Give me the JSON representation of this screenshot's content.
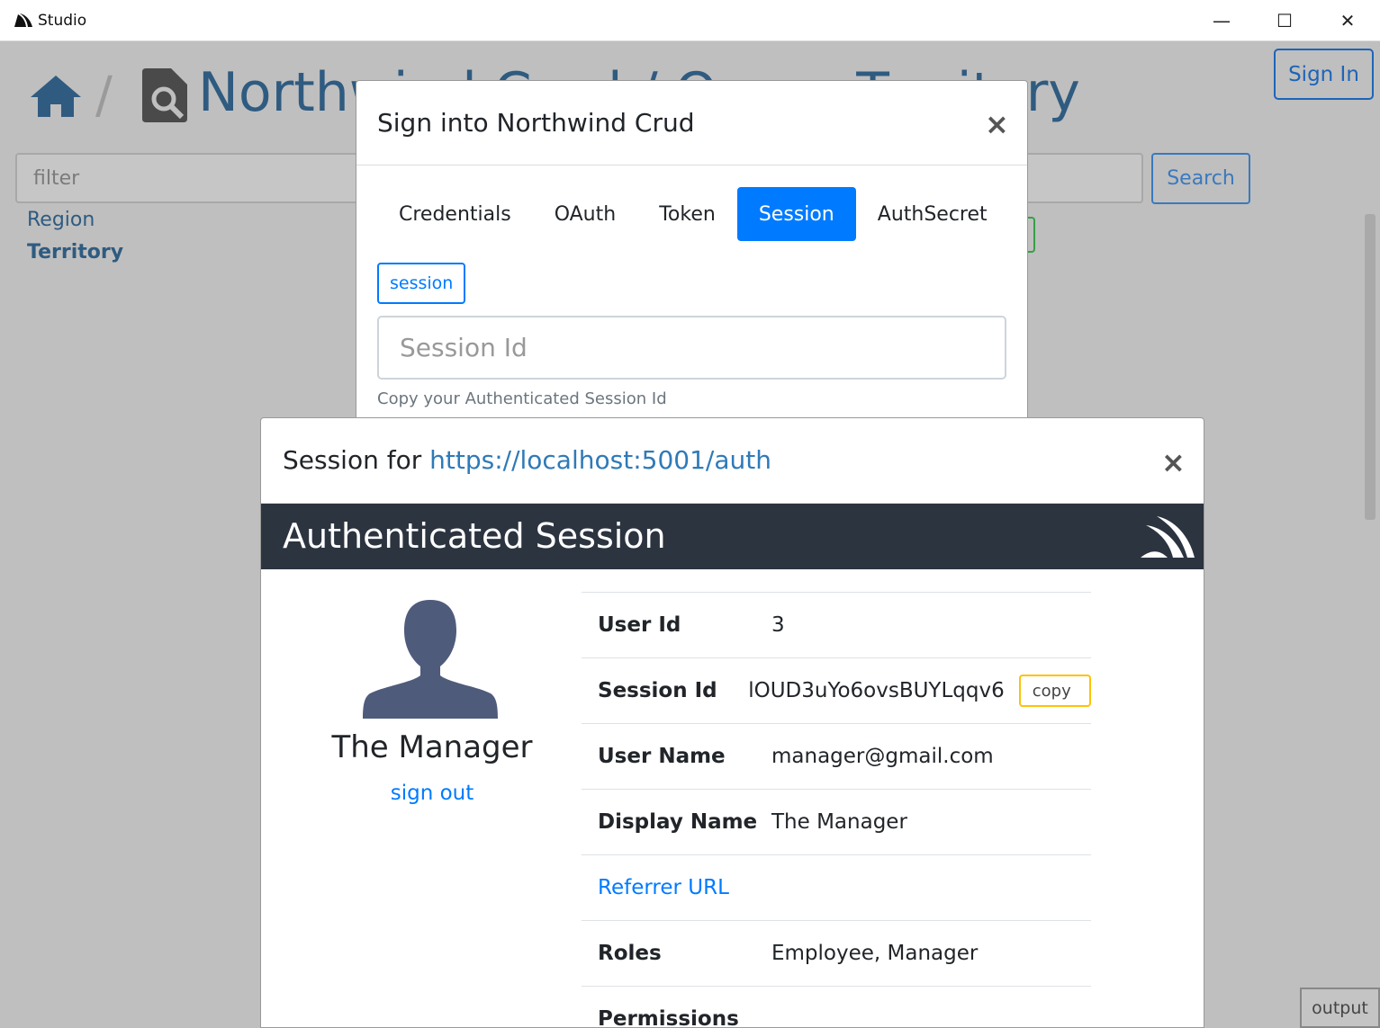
{
  "window": {
    "title": "Studio",
    "controls": {
      "minimize": "—",
      "maximize": "☐",
      "close": "✕"
    }
  },
  "app": {
    "heading": "Northwind Crud / Query Territory",
    "breadcrumb_separator": "/",
    "signin_label": "Sign In",
    "filter_placeholder": "filter",
    "search_label": "Search",
    "nav": [
      "Region",
      "Territory"
    ],
    "output_label": "output"
  },
  "signin_modal": {
    "title": "Sign into Northwind Crud",
    "close": "×",
    "tabs": [
      "Credentials",
      "OAuth",
      "Token",
      "Session",
      "AuthSecret"
    ],
    "active_tab": "Session",
    "tag": "session",
    "session_id_placeholder": "Session Id",
    "help_text": "Copy your Authenticated Session Id"
  },
  "session_modal": {
    "title_prefix": "Session for ",
    "title_url": "https://localhost:5001/auth",
    "close": "×",
    "banner_title": "Authenticated Session",
    "profile_name": "The Manager",
    "signout_label": "sign out",
    "rows": [
      {
        "key": "User Id",
        "value": "3"
      },
      {
        "key": "Session Id",
        "value": "lOUD3uYo6ovsBUYLqqv6",
        "action": "copy"
      },
      {
        "key": "User Name",
        "value": "manager@gmail.com"
      },
      {
        "key": "Display Name",
        "value": "The Manager"
      },
      {
        "link": "Referrer URL"
      },
      {
        "key": "Roles",
        "value": "Employee, Manager"
      },
      {
        "key": "Permissions",
        "value": ""
      }
    ]
  },
  "colors": {
    "primary": "#007bff",
    "banner": "#2c3440",
    "heading": "#2f5b80",
    "copy_border": "#ffc107"
  }
}
